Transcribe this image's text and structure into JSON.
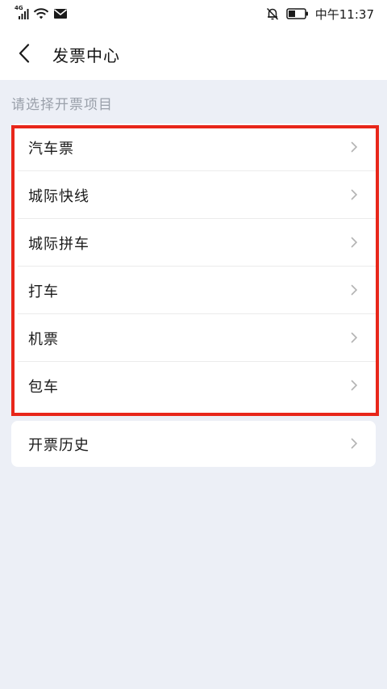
{
  "status_bar": {
    "network_label": "4G",
    "time": "中午11:37"
  },
  "header": {
    "title": "发票中心"
  },
  "section": {
    "label": "请选择开票项目"
  },
  "invoice_items": [
    {
      "label": "汽车票"
    },
    {
      "label": "城际快线"
    },
    {
      "label": "城际拼车"
    },
    {
      "label": "打车"
    },
    {
      "label": "机票"
    },
    {
      "label": "包车"
    }
  ],
  "history": {
    "label": "开票历史"
  },
  "colors": {
    "background": "#eceff6",
    "highlight": "#e8261a",
    "muted_text": "#9aa0aa"
  }
}
